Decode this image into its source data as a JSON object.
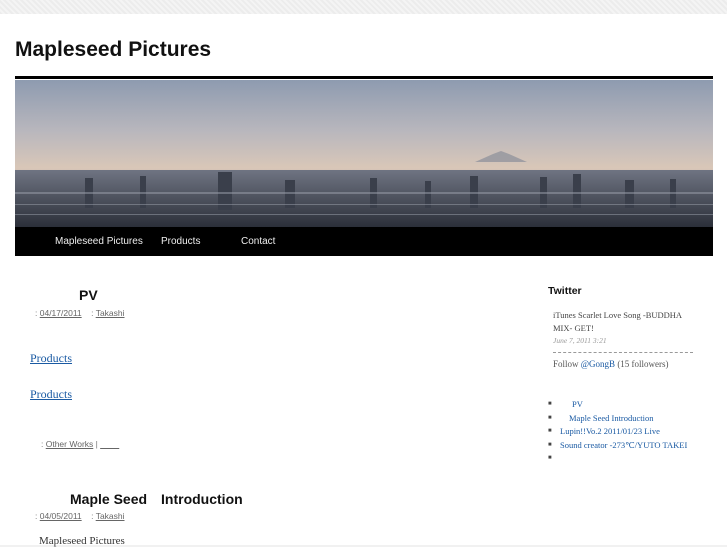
{
  "site": {
    "title": "Mapleseed Pictures"
  },
  "nav": {
    "items": [
      "Mapleseed Pictures",
      "Products",
      "Contact"
    ]
  },
  "posts": [
    {
      "title": "PV",
      "date": "04/17/2011",
      "author": "Takashi",
      "links": [
        "Products",
        "Products"
      ],
      "category": "Other Works",
      "separator": "|",
      "comments": "____"
    },
    {
      "title": "Maple Seed　Introduction",
      "date": "04/05/2011",
      "author": "Takashi",
      "excerpt": "Mapleseed Pictures"
    }
  ],
  "sidebar": {
    "twitter": {
      "title": "Twitter",
      "tweet": "iTunes  Scarlet Love Song -BUDDHA MIX- GET!",
      "date": "June 7, 2011 3:21",
      "follow_prefix": "Follow",
      "handle": "@GongB",
      "followers": "(15 followers)"
    },
    "recent": [
      "PV",
      "Maple Seed  Introduction",
      "Lupin!!Vo.2 2011/01/23 Live",
      "",
      "Sound creator -273℃/YUTO TAKEI",
      ""
    ]
  }
}
